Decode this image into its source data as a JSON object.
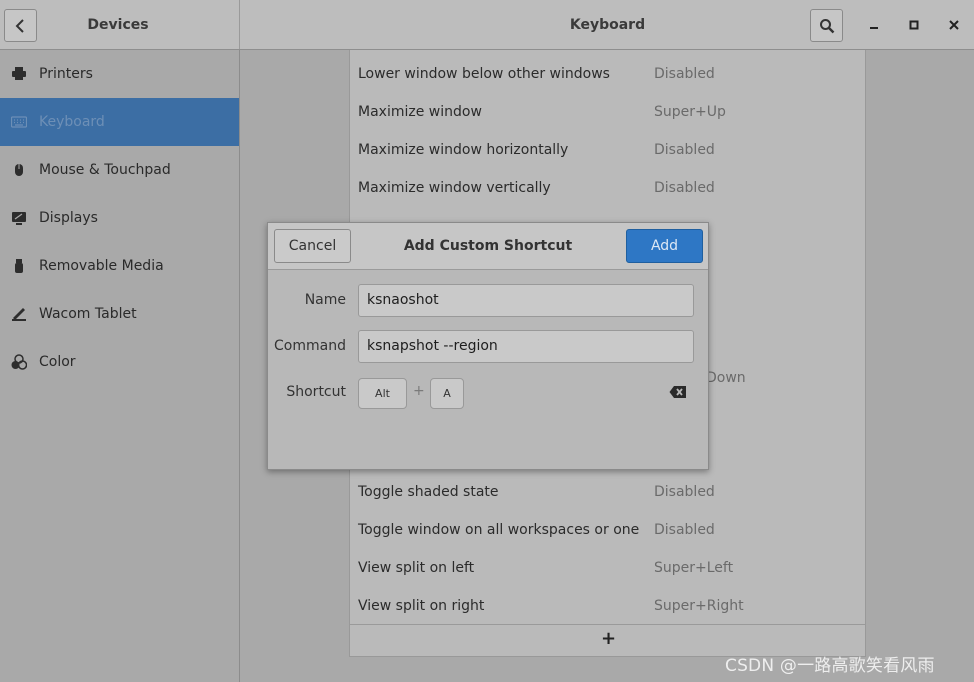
{
  "header": {
    "left_title": "Devices",
    "main_title": "Keyboard"
  },
  "sidebar": {
    "items": [
      {
        "label": "Printers",
        "icon": "printer-icon"
      },
      {
        "label": "Keyboard",
        "icon": "keyboard-icon",
        "selected": true
      },
      {
        "label": "Mouse & Touchpad",
        "icon": "mouse-icon"
      },
      {
        "label": "Displays",
        "icon": "display-icon"
      },
      {
        "label": "Removable Media",
        "icon": "usb-icon"
      },
      {
        "label": "Wacom Tablet",
        "icon": "tablet-icon"
      },
      {
        "label": "Color",
        "icon": "color-icon"
      }
    ]
  },
  "shortcuts": {
    "rows": [
      {
        "name": "Lower window below other windows",
        "accel": "Disabled"
      },
      {
        "name": "Maximize window",
        "accel": "Super+Up"
      },
      {
        "name": "Maximize window horizontally",
        "accel": "Disabled"
      },
      {
        "name": "Maximize window vertically",
        "accel": "Disabled"
      },
      {
        "name": "Toggle shaded state",
        "accel": "Disabled"
      },
      {
        "name": "Toggle window on all workspaces or one",
        "accel": "Disabled"
      },
      {
        "name": "View split on left",
        "accel": "Super+Left"
      },
      {
        "name": "View split on right",
        "accel": "Super+Right"
      }
    ],
    "partial_accel": "Down",
    "add_label": "+"
  },
  "dialog": {
    "title": "Add Custom Shortcut",
    "cancel_label": "Cancel",
    "add_label": "Add",
    "name_label": "Name",
    "name_value": "ksnaoshot",
    "command_label": "Command",
    "command_value": "ksnapshot --region",
    "shortcut_label": "Shortcut",
    "keys": [
      "Alt",
      "A"
    ],
    "plus": "+"
  },
  "watermark": "CSDN @一路高歌笑看风雨",
  "colors": {
    "accent": "#2e77c5",
    "selected_sidebar": "#3c6ea4"
  }
}
